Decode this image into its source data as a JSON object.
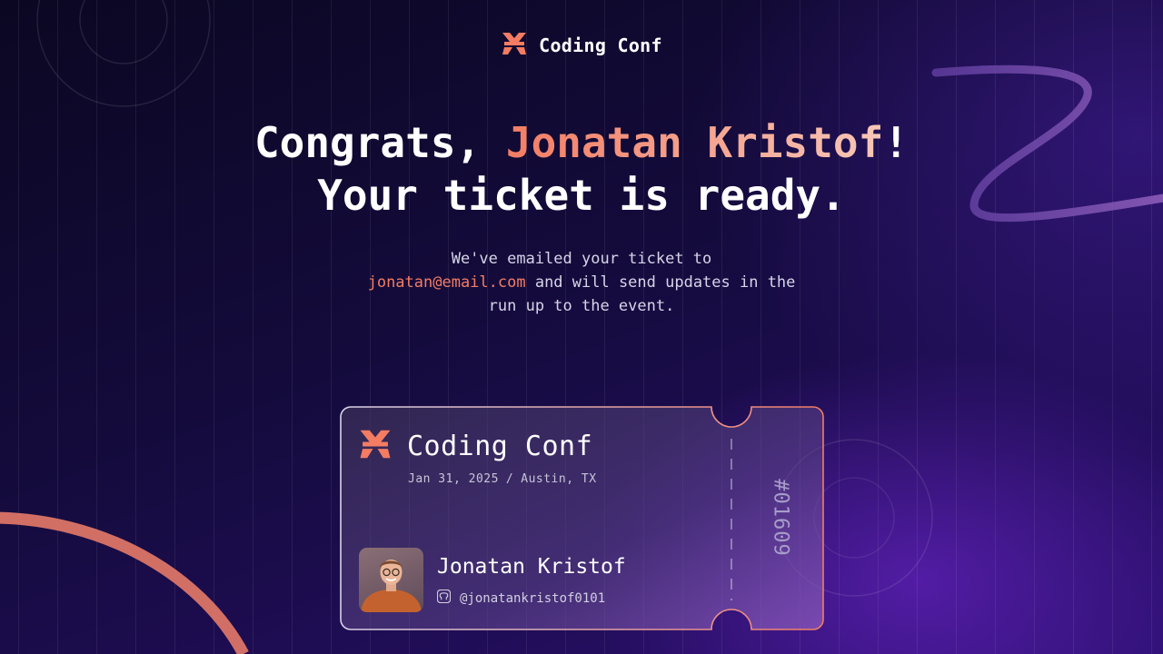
{
  "brand": {
    "name": "Coding Conf",
    "icon": "coding-conf-logo-icon",
    "accent_color": "#f37c63"
  },
  "headline": {
    "greeting": "Congrats, ",
    "name": "Jonatan Kristof",
    "exclaim": "!",
    "line2": "Your ticket is ready."
  },
  "message": {
    "part1": "We've emailed your ticket to",
    "email": "jonatan@email.com",
    "part2": " and will send updates in the run up to the event."
  },
  "ticket": {
    "brand_name": "Coding Conf",
    "date": "Jan 31, 2025",
    "separator": "/",
    "location": "Austin, TX",
    "attendee_name": "Jonatan Kristof",
    "github_icon": "github-icon",
    "github_handle": "@jonatankristof0101",
    "number": "#01609"
  },
  "colors": {
    "accent": "#f37c63",
    "background_dark": "#0b0722",
    "background_purple": "#2a0f6e"
  }
}
